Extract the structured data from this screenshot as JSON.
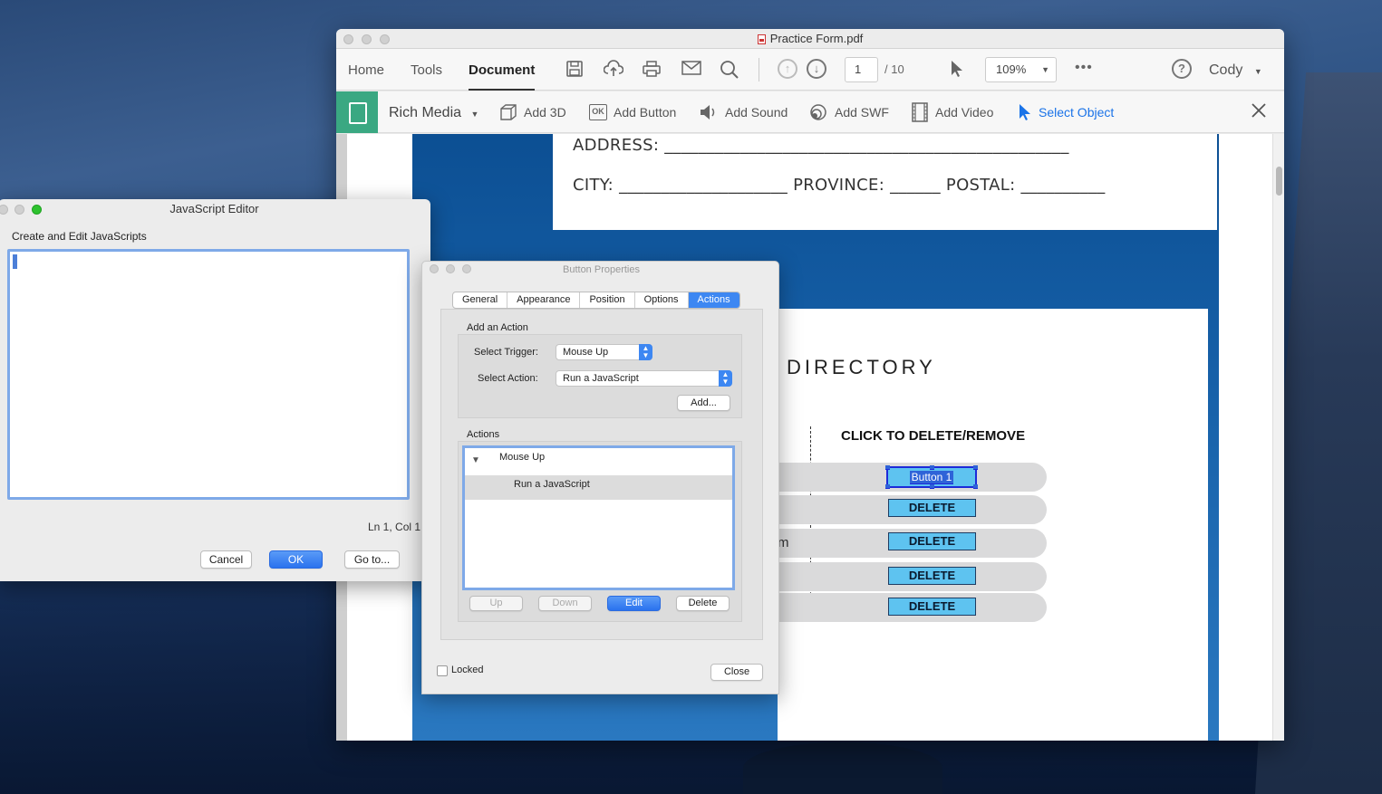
{
  "acrobat": {
    "window_title": "Practice Form.pdf",
    "nav": {
      "home": "Home",
      "tools": "Tools",
      "document": "Document"
    },
    "page_current": "1",
    "page_total": "/ 10",
    "zoom": "109%",
    "user": "Cody",
    "more": "•••",
    "help": "?",
    "icons": [
      "save-icon",
      "upload-icon",
      "print-icon",
      "mail-icon",
      "search-icon",
      "page-up-icon",
      "page-down-icon",
      "pointer-icon"
    ]
  },
  "rich_media": {
    "title": "Rich Media",
    "add_3d": "Add 3D",
    "add_button": "Add Button",
    "add_button_icon_text": "OK",
    "add_sound": "Add Sound",
    "add_swf": "Add SWF",
    "add_video": "Add Video",
    "select_object": "Select Object"
  },
  "document": {
    "address_line": "ADDRESS: ________________________________________________",
    "city_line": "CITY: ____________________ PROVINCE: ______ POSTAL: __________",
    "directory_title": "DIRECTORY",
    "column_header": "CLICK TO DELETE/REMOVE",
    "selected_button": "Button 1",
    "delete_label": "DELETE",
    "row_fragment": "m"
  },
  "js_editor": {
    "title": "JavaScript Editor",
    "label": "Create and Edit JavaScripts",
    "content": "",
    "cursor_pos": "Ln 1, Col 1",
    "cancel": "Cancel",
    "ok": "OK",
    "goto": "Go to..."
  },
  "button_properties": {
    "title": "Button Properties",
    "tabs": [
      "General",
      "Appearance",
      "Position",
      "Options",
      "Actions"
    ],
    "active_tab": "Actions",
    "add_action_label": "Add an Action",
    "trigger_label": "Select Trigger:",
    "trigger_value": "Mouse Up",
    "action_label": "Select Action:",
    "action_value": "Run a JavaScript",
    "add_btn": "Add...",
    "actions_label": "Actions",
    "tree_parent": "Mouse Up",
    "tree_child": "Run a JavaScript",
    "up": "Up",
    "down": "Down",
    "edit": "Edit",
    "delete": "Delete",
    "locked": "Locked",
    "close": "Close"
  },
  "colors": {
    "accent": "#3d87f2",
    "rich_media_green": "#3aa882",
    "select_blue": "#1a73e8",
    "delete_button": "#5ec3f0"
  }
}
